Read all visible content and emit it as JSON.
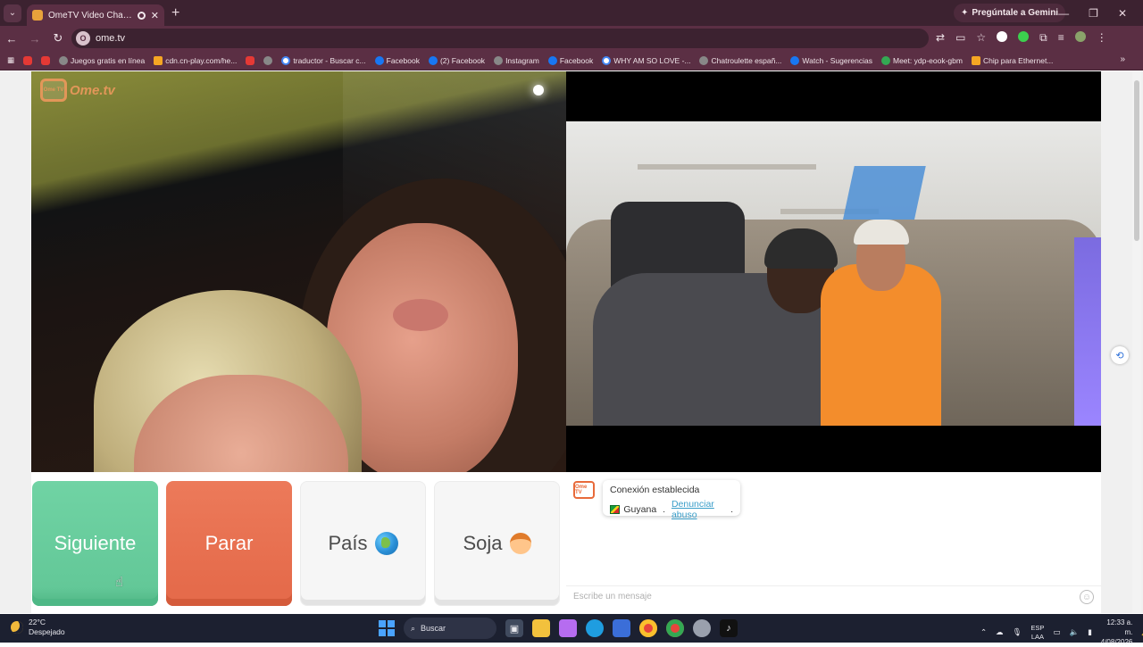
{
  "browser": {
    "tab_title": "OmeTV Video Chat — Alte",
    "tab_close": "✕",
    "new_tab": "+",
    "gemini_label": "Pregúntale a Gemini",
    "url": "ome.tv",
    "site_badge": "O",
    "min": "—",
    "max": "❐",
    "close": "✕",
    "back": "←",
    "forward": "→",
    "reload": "↻",
    "bookmarks": [
      {
        "label": "",
        "icon": "yt"
      },
      {
        "label": "",
        "icon": "yt"
      },
      {
        "label": "Juegos gratis en línea",
        "icon": "gl"
      },
      {
        "label": "cdn.cn-play.com/he...",
        "icon": "or"
      },
      {
        "label": "",
        "icon": "yt"
      },
      {
        "label": "",
        "icon": "gl"
      },
      {
        "label": "traductor - Buscar c...",
        "icon": "g"
      },
      {
        "label": "Facebook",
        "icon": "fb"
      },
      {
        "label": "(2) Facebook",
        "icon": "fb"
      },
      {
        "label": "Instagram",
        "icon": "gl"
      },
      {
        "label": "Facebook",
        "icon": "fb"
      },
      {
        "label": "WHY AM SO LOVE -...",
        "icon": "g"
      },
      {
        "label": "Chatroulette españ...",
        "icon": "gl"
      },
      {
        "label": "Watch - Sugerencias",
        "icon": "fb"
      },
      {
        "label": "Meet: ydp-eook-gbm",
        "icon": "meet"
      },
      {
        "label": "Chip para Ethernet...",
        "icon": "or"
      }
    ],
    "bookmarks_more": "»"
  },
  "ometv": {
    "logo_small": "Ome TV",
    "logo_word": "Ome.tv",
    "buttons": {
      "next": "Siguiente",
      "stop": "Parar",
      "country": "País",
      "gender": "Soja"
    },
    "chat": {
      "logo": "Ome TV",
      "status": "Conexión establecida",
      "country": "Guyana",
      "separator": " . ",
      "report_link": "Denunciar abuso",
      "report_end": ".",
      "input_placeholder": "Escribe un mensaje"
    }
  },
  "taskbar": {
    "temp": "22°C",
    "weather": "Despejado",
    "search_label": "Buscar",
    "lang_top": "ESP",
    "lang_bottom": "LAA",
    "time": "12:33 a. m.",
    "date": "4/08/2026"
  }
}
